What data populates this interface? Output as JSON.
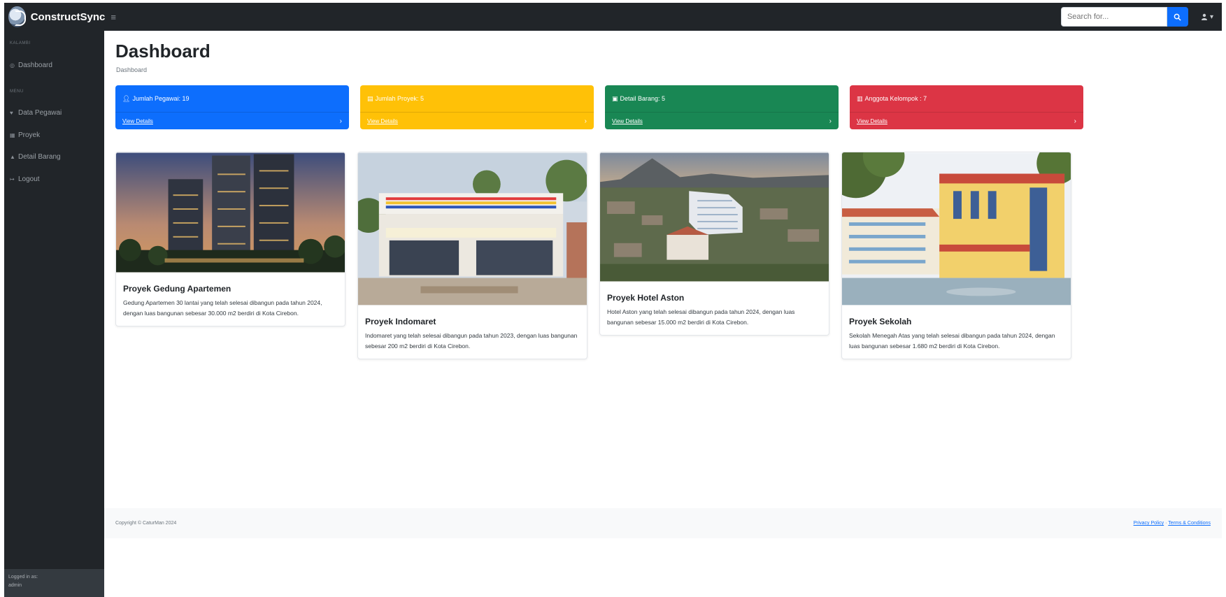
{
  "brand": {
    "name": "ConstructSync",
    "logo_icon": "constructsync-logo",
    "toggle_icon": "hamburger-icon"
  },
  "search": {
    "placeholder": "Search for...",
    "button_icon": "search-icon"
  },
  "user_menu": {
    "icon": "user-icon",
    "caret_icon": "caret-down-icon"
  },
  "sidebar": {
    "sections": [
      {
        "heading": "KALAMBI",
        "items": [
          {
            "label": "Dashboard",
            "icon": "gauge-icon"
          }
        ]
      },
      {
        "heading": "MENU",
        "items": [
          {
            "label": "Data Pegawai",
            "icon": "users-icon"
          },
          {
            "label": "Proyek",
            "icon": "building-icon"
          },
          {
            "label": "Detail Barang",
            "icon": "box-icon"
          },
          {
            "label": "Logout",
            "icon": "logout-icon"
          }
        ]
      }
    ],
    "footer": {
      "caption": "Logged in as:",
      "user": "admin"
    }
  },
  "page": {
    "title": "Dashboard",
    "breadcrumb": "Dashboard"
  },
  "stats": [
    {
      "label": "Jumlah Pegawai: 19",
      "icon": "user-icon",
      "link": "View Details",
      "color": "#0d6efd"
    },
    {
      "label": "Jumlah Proyek: 5",
      "icon": "table-icon",
      "link": "View Details",
      "color": "#ffc107"
    },
    {
      "label": "Detail Barang: 5",
      "icon": "images-icon",
      "link": "View Details",
      "color": "#198754"
    },
    {
      "label": "Anggota Kelompok : 7",
      "icon": "group-icon",
      "link": "View Details",
      "color": "#dc3545"
    }
  ],
  "projects": [
    {
      "title": "Proyek Gedung Apartemen",
      "description": "Gedung Apartemen 30 lantai yang telah selesai dibangun pada tahun 2024, dengan luas bangunan sebesar 30.000 m2 berdiri di Kota Cirebon."
    },
    {
      "title": "Proyek Indomaret",
      "description": "Indomaret yang telah selesai dibangun pada tahun 2023, dengan luas bangunan sebesar 200 m2 berdiri di Kota Cirebon."
    },
    {
      "title": "Proyek Hotel Aston",
      "description": "Hotel Aston yang telah selesai dibangun pada tahun 2024, dengan luas bangunan sebesar 15.000 m2 berdiri di Kota Cirebon."
    },
    {
      "title": "Proyek Sekolah",
      "description": "Sekolah Menegah Atas yang telah selesai dibangun pada tahun 2024, dengan luas bangunan sebesar 1.680 m2 berdiri di Kota Cirebon."
    }
  ],
  "footer": {
    "copyright": "Copyright © CaturMan 2024",
    "privacy": "Privacy Policy",
    "separator": "·",
    "terms": "Terms & Conditions"
  }
}
